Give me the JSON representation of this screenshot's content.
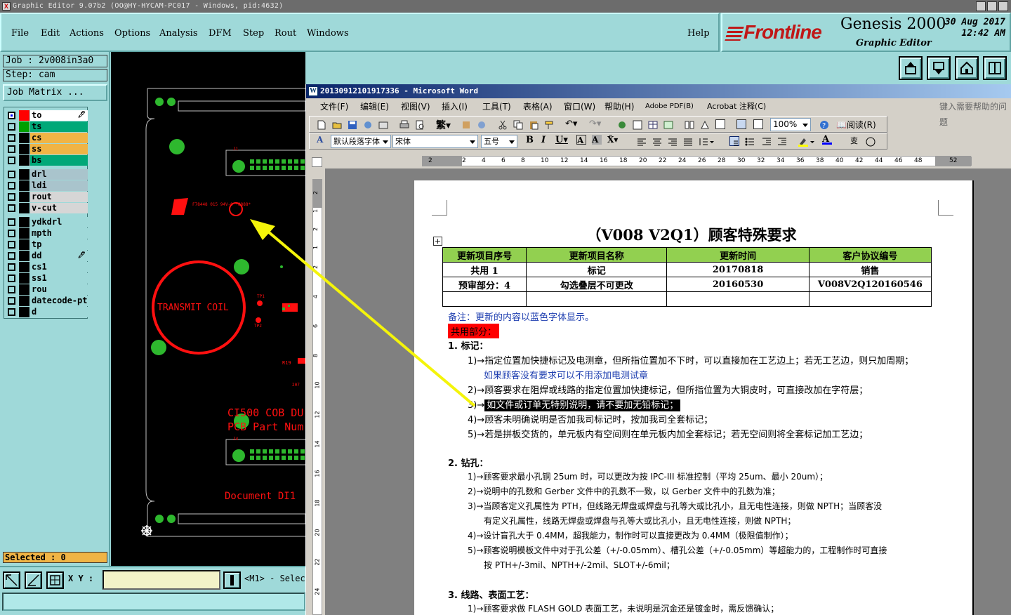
{
  "ge": {
    "title": "Graphic Editor 9.07b2 (OO@HY-HYCAM-PC017 - Windows, pid:4632)",
    "menu": [
      "File",
      "Edit",
      "Actions",
      "Options",
      "Analysis",
      "DFM",
      "Step",
      "Rout",
      "Windows"
    ],
    "help": "Help",
    "brand": "Frontline",
    "product": "Genesis 2000",
    "subtitle": "Graphic Editor",
    "date": "30 Aug 2017",
    "time": "12:42 AM",
    "job": "Job : 2v008in3a0",
    "step": "Step: cam",
    "job_matrix": "Job Matrix ...",
    "layers": [
      {
        "name": "to",
        "color": "#00bcbc",
        "swatch": "#ff0000",
        "on": true,
        "nameBg": "#ffffff",
        "flag": "🖊"
      },
      {
        "name": "ts",
        "nameBg": "#00a878",
        "swatch": "#00a000"
      },
      {
        "name": "cs",
        "nameBg": "#f0b445"
      },
      {
        "name": "ss",
        "nameBg": "#f0b445"
      },
      {
        "name": "bs",
        "nameBg": "#00a878"
      },
      {
        "name": "drl",
        "nameBg": "#a9c4cc"
      },
      {
        "name": "ldi",
        "nameBg": "#a9c4cc"
      },
      {
        "name": "rout",
        "nameBg": "#d6d6d6"
      },
      {
        "name": "v-cut",
        "nameBg": "#d6d6d6"
      },
      {
        "name": "ydkdrl",
        "nameBg": "#9fd9d9"
      },
      {
        "name": "mpth",
        "nameBg": "#9fd9d9"
      },
      {
        "name": "tp",
        "nameBg": "#9fd9d9"
      },
      {
        "name": "dd",
        "nameBg": "#9fd9d9",
        "flag": "🖊"
      },
      {
        "name": "cs1",
        "nameBg": "#9fd9d9"
      },
      {
        "name": "ss1",
        "nameBg": "#9fd9d9"
      },
      {
        "name": "rou",
        "nameBg": "#9fd9d9"
      },
      {
        "name": "datecode-pt",
        "nameBg": "#9fd9d9"
      },
      {
        "name": "d",
        "nameBg": "#9fd9d9"
      }
    ],
    "selected": "Selected : 0",
    "xy_label": "X Y :",
    "mode": "<M1> - Selec",
    "pcb_text": {
      "transmit": "TRANSMIT COIL",
      "board1": "CI500 COB DU",
      "board2": "PCB Part Num",
      "doc": "Document DI1",
      "j1": "J1",
      "j4": "J4",
      "tp1": "TP1",
      "tp2": "TP2",
      "r19": "R19",
      "mark": "F78448 015 94V-0 *8888*",
      "c20": "207"
    }
  },
  "word": {
    "title": "20130912101917336 - Microsoft Word",
    "menu": [
      "文件(F)",
      "编辑(E)",
      "视图(V)",
      "插入(I)",
      "工具(T)",
      "表格(A)",
      "窗口(W)",
      "帮助(H)",
      "Adobe PDF(B)",
      "Acrobat 注释(C)"
    ],
    "help_hint": "键入需要帮助的问题",
    "zoom": "100%",
    "read": "阅读(R)",
    "style": "默认段落字体",
    "font": "宋体",
    "size": "五号",
    "ruler_h": [
      "2",
      "2",
      "4",
      "6",
      "8",
      "10",
      "12",
      "14",
      "16",
      "18",
      "20",
      "22",
      "24",
      "26",
      "28",
      "30",
      "32",
      "34",
      "36",
      "38",
      "40",
      "42",
      "44",
      "46",
      "48",
      "52"
    ],
    "ruler_v": [
      "2",
      "1",
      "2",
      "1",
      "2",
      "4",
      "6",
      "8",
      "10",
      "12",
      "14",
      "16",
      "18",
      "20",
      "22",
      "24",
      "26"
    ],
    "doc_title": "（V008 V2Q1）顾客特殊要求",
    "table": {
      "header": [
        "更新项目序号",
        "更新项目名称",
        "更新时间",
        "客户协议编号"
      ],
      "rows": [
        [
          "共用 1",
          "标记",
          "20170818",
          "销售"
        ],
        [
          "预审部分：4",
          "勾选叠层不可更改",
          "20160530",
          "V008V2Q120160546"
        ],
        [
          "",
          "",
          "",
          ""
        ]
      ]
    },
    "remark": "备注：更新的内容以蓝色字体显示。",
    "common": "共用部分：",
    "s1": "1. 标记：",
    "s1_items": [
      "1)→指定位置加快捷标记及电测章，但所指位置加不下时，可以直接加在工艺边上；若无工艺边，则只加周期；",
      "如果顾客没有要求可以不用添加电测试章",
      "2)→顾客要求在阻焊或线路的指定位置加快捷标记，但所指位置为大铜皮时，可直接改加在字符层；",
      "如文件或订单无特别说明，请不要加无铅标记；",
      "4)→顾客未明确说明是否加我司标记时，按加我司全套标记；",
      "5)→若是拼板交货的，单元板内有空间则在单元板内加全套标记；若无空间则将全套标记加工艺边；"
    ],
    "s2": "2. 钻孔：",
    "s2_items": [
      "1)→顾客要求最小孔铜 25um 时，可以更改为按 IPC-III 标准控制（平均 25um、最小 20um）；",
      "2)→说明中的孔数和 Gerber 文件中的孔数不一致，以 Gerber 文件中的孔数为准；",
      "3)→当顾客定义孔属性为 PTH，但线路无焊盘或焊盘与孔等大或比孔小，且无电性连接，则做 NPTH；当顾客没",
      "有定义孔属性，线路无焊盘或焊盘与孔等大或比孔小，且无电性连接，则做 NPTH；",
      "4)→设计盲孔大于 0.4MM，超我能力，制作时可以直接更改为 0.4MM（极限值制作）；",
      "5)→顾客说明模板文件中对于孔公差（+/-0.05mm）、槽孔公差（+/-0.05mm）等超能力的，工程制作时可直接",
      "按 PTH+/-3mil、NPTH+/-2mil、SLOT+/-6mil；"
    ],
    "s3": "3. 线路、表面工艺：",
    "s3_items": [
      "1)→顾客要求做 FLASH GOLD 表面工艺，未说明是沉金还是镀金时，需反馈确认；"
    ]
  }
}
